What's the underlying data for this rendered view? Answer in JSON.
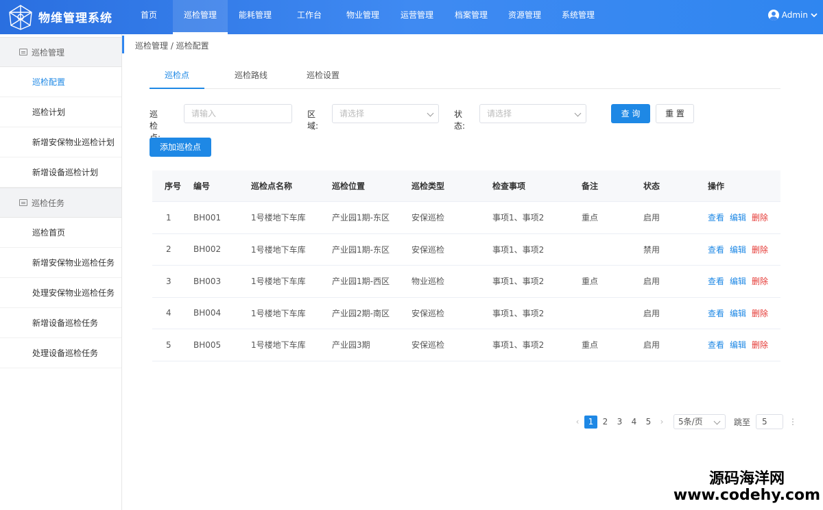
{
  "header": {
    "brand": "物维管理系统",
    "nav": [
      "首页",
      "巡检管理",
      "能耗管理",
      "工作台",
      "物业管理",
      "运营管理",
      "档案管理",
      "资源管理",
      "系统管理"
    ],
    "active_nav": "巡检管理",
    "user": "Admin"
  },
  "sidebar": {
    "group1": "巡检管理",
    "group1_items": [
      "巡检配置",
      "巡检计划",
      "新增安保物业巡检计划",
      "新增设备巡检计划"
    ],
    "group2": "巡检任务",
    "group2_items": [
      "巡检首页",
      "新增安保物业巡检任务",
      "处理安保物业巡检任务",
      "新增设备巡检任务",
      "处理设备巡检任务"
    ],
    "active_item": "巡检配置"
  },
  "breadcrumb": "巡检管理 / 巡检配置",
  "tabs": [
    "巡检点",
    "巡检路线",
    "巡检设置"
  ],
  "filters": {
    "point_label": "巡检点:",
    "point_placeholder": "请输入",
    "area_label": "区域:",
    "area_placeholder": "请选择",
    "status_label": "状态:",
    "status_placeholder": "请选择",
    "search_btn": "查 询",
    "reset_btn": "重 置"
  },
  "add_button": "添加巡检点",
  "table": {
    "headers": [
      "序号",
      "编号",
      "巡检点名称",
      "巡检位置",
      "巡检类型",
      "检查事项",
      "备注",
      "状态",
      "操作"
    ],
    "rows": [
      [
        "1",
        "BH001",
        "1号楼地下车库",
        "产业园1期-东区",
        "安保巡检",
        "事项1、事项2",
        "重点",
        "启用"
      ],
      [
        "2",
        "BH002",
        "1号楼地下车库",
        "产业园1期-东区",
        "安保巡检",
        "事项1、事项2",
        "",
        "禁用"
      ],
      [
        "3",
        "BH003",
        "1号楼地下车库",
        "产业园1期-西区",
        "物业巡检",
        "事项1、事项2",
        "重点",
        "启用"
      ],
      [
        "4",
        "BH004",
        "1号楼地下车库",
        "产业园2期-南区",
        "安保巡检",
        "事项1、事项2",
        "",
        "启用"
      ],
      [
        "5",
        "BH005",
        "1号楼地下车库",
        "产业园3期",
        "安保巡检",
        "事项1、事项2",
        "重点",
        "启用"
      ]
    ],
    "actions": [
      "查看",
      "编辑",
      "删除"
    ]
  },
  "pagination": {
    "pages": [
      "1",
      "2",
      "3",
      "4",
      "5"
    ],
    "current": "1",
    "page_size": "5条/页",
    "jump_label": "跳至",
    "jump_value": "5"
  },
  "watermark": {
    "line1": "源码海洋网",
    "line2": "www.codehy.com"
  },
  "colors": {
    "primary": "#1e88e5",
    "danger": "#e53935",
    "topbar": "#3f8af2"
  }
}
